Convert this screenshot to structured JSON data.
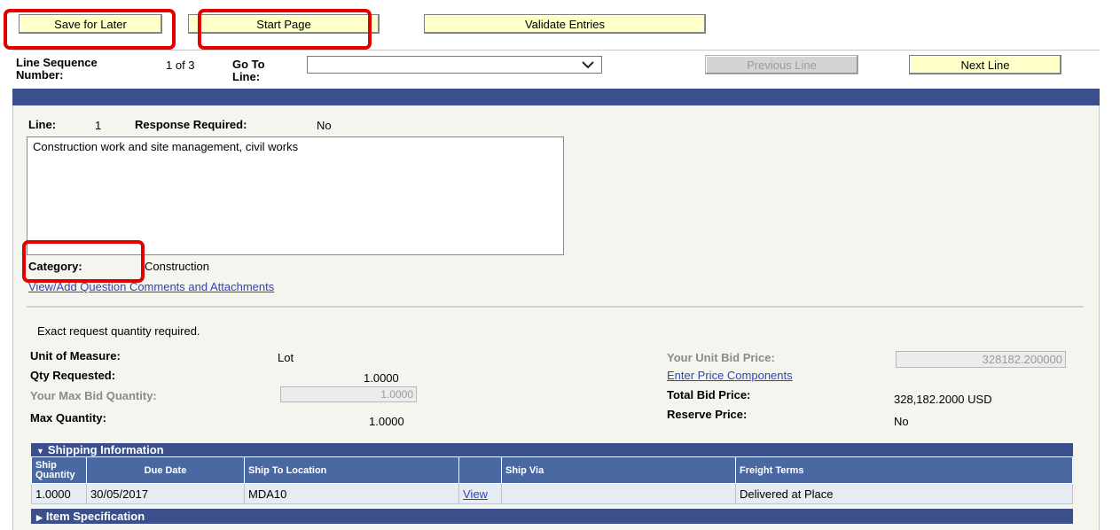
{
  "toolbar": {
    "save_for_later": "Save for Later",
    "start_page": "Start Page",
    "validate_entries": "Validate Entries"
  },
  "nav": {
    "line_sequence_label": "Line Sequence Number:",
    "line_sequence_value": "1 of 3",
    "goto_label": "Go To Line:",
    "goto_value": "",
    "previous_line": "Previous Line",
    "next_line": "Next Line"
  },
  "line": {
    "line_label": "Line:",
    "line_number": "1",
    "response_required_label": "Response Required:",
    "response_required_value": "No",
    "description": "Construction work and site management, civil works",
    "category_label": "Category:",
    "category_value": "Construction",
    "comments_link": "View/Add Question Comments and Attachments"
  },
  "quantities": {
    "exact_note": "Exact request quantity required.",
    "uom_label": "Unit of Measure:",
    "uom_value": "Lot",
    "qty_requested_label": "Qty Requested:",
    "qty_requested_value": "1.0000",
    "max_bid_qty_label": "Your Max Bid Quantity:",
    "max_bid_qty_value": "1.0000",
    "max_qty_label": "Max Quantity:",
    "max_qty_value": "1.0000"
  },
  "pricing": {
    "unit_bid_price_label": "Your Unit Bid Price:",
    "unit_bid_price_value": "328182.200000",
    "enter_price_components": "Enter Price Components",
    "total_bid_price_label": "Total Bid Price:",
    "total_bid_price_value": "328,182.2000 USD",
    "reserve_price_label": "Reserve Price:",
    "reserve_price_value": "No"
  },
  "shipping": {
    "section_title": "Shipping Information",
    "columns": [
      "Ship Quantity",
      "Due Date",
      "Ship To Location",
      "",
      "Ship Via",
      "Freight Terms"
    ],
    "rows": [
      [
        "1.0000",
        "30/05/2017",
        "MDA10",
        "View",
        "",
        "Delivered at Place"
      ]
    ]
  },
  "item_spec": {
    "section_title": "Item Specification"
  },
  "colors": {
    "button_bg": "#ffffc8",
    "header_bar": "#3b4f8c",
    "panel_bg": "#f4f5ef",
    "highlight": "#e00000",
    "link": "#3144b4"
  }
}
